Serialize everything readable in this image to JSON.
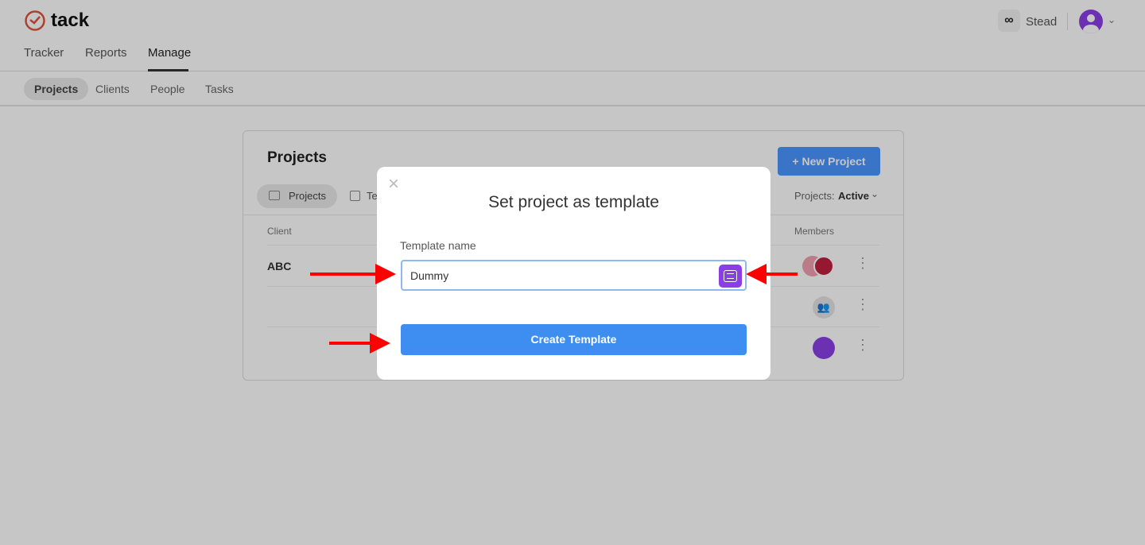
{
  "app": {
    "name": "tack",
    "brand_color": "#e0543c"
  },
  "nav": {
    "items": [
      {
        "label": "Tracker"
      },
      {
        "label": "Reports"
      },
      {
        "label": "Manage",
        "active": true
      }
    ]
  },
  "workspace": {
    "name": "Stead"
  },
  "subnav": {
    "items": [
      {
        "label": "Projects",
        "active": true
      },
      {
        "label": "Clients"
      },
      {
        "label": "People"
      },
      {
        "label": "Tasks"
      }
    ]
  },
  "projects": {
    "title": "Projects",
    "new_button": "+ New Project",
    "tabs": [
      {
        "label": "Projects"
      },
      {
        "label": "Te"
      }
    ],
    "filter_label": "Projects:",
    "filter_value": "Active",
    "columns": {
      "client": "Client",
      "members": "Members"
    },
    "rows": [
      {
        "client": "ABC"
      },
      {
        "client": ""
      },
      {
        "client": ""
      }
    ]
  },
  "modal": {
    "title": "Set project as template",
    "field_label": "Template name",
    "field_value": "Dummy",
    "submit": "Create Template",
    "accent": "#3d8ef0",
    "icon_color": "#8b3ee6"
  }
}
